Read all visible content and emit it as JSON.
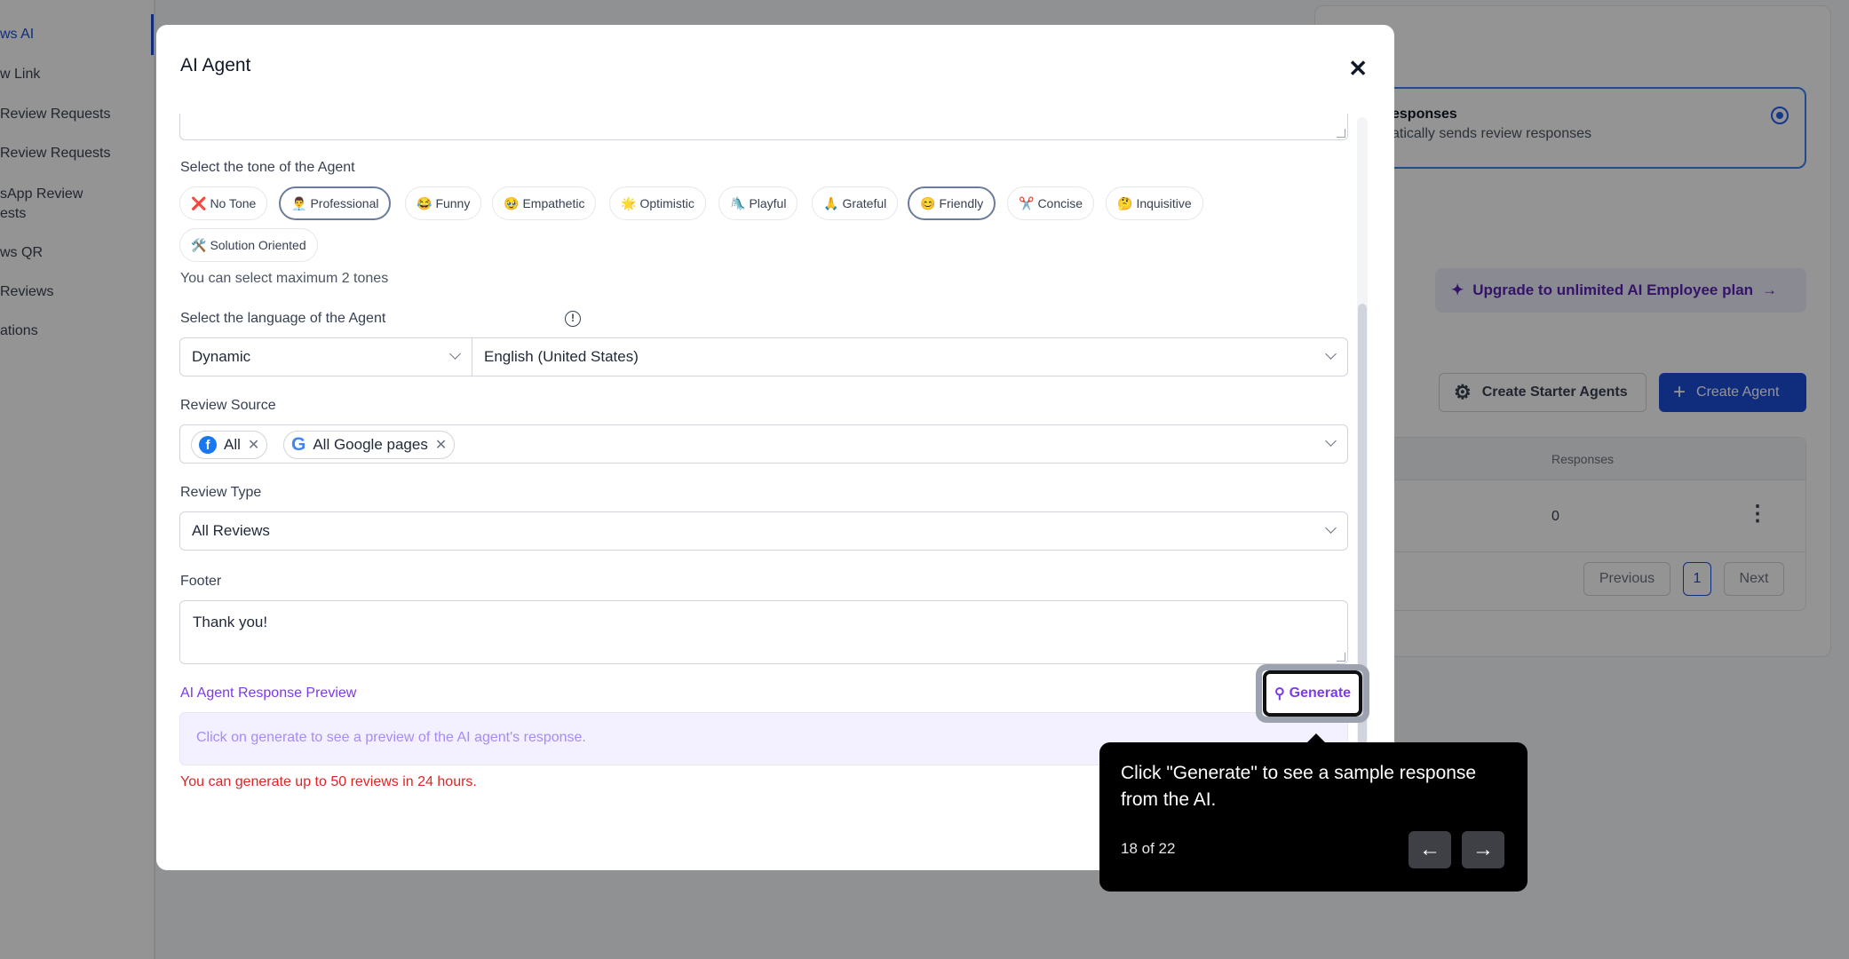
{
  "sidebar": {
    "items": [
      {
        "label": "ws AI",
        "active": true
      },
      {
        "label": "w Link"
      },
      {
        "label": "Review Requests"
      },
      {
        "label": " Review Requests"
      },
      {
        "label": "sApp Review"
      },
      {
        "label": "ests"
      },
      {
        "label": "ws QR"
      },
      {
        "label": " Reviews"
      },
      {
        "label": "ations"
      }
    ]
  },
  "background": {
    "option_card": {
      "title": "esponses",
      "subtitle": "atically sends review responses",
      "selected": true
    },
    "upgrade_label": "Upgrade to unlimited AI Employee plan",
    "create_starter_label": "Create Starter Agents",
    "create_agent_label": "Create Agent",
    "table": {
      "column": "Responses",
      "value": "0"
    },
    "pagination": {
      "previous": "Previous",
      "current": "1",
      "next": "Next"
    }
  },
  "modal": {
    "title": "AI Agent",
    "close_icon": "close-icon",
    "tone_label": "Select the tone of the Agent",
    "tones": [
      {
        "emoji": "❌",
        "label": "No Tone",
        "selected": false
      },
      {
        "emoji": "👨‍💼",
        "label": "Professional",
        "selected": true
      },
      {
        "emoji": "😂",
        "label": "Funny",
        "selected": false
      },
      {
        "emoji": "🥹",
        "label": "Empathetic",
        "selected": false
      },
      {
        "emoji": "🌟",
        "label": "Optimistic",
        "selected": false
      },
      {
        "emoji": "🛝",
        "label": "Playful",
        "selected": false
      },
      {
        "emoji": "🙏",
        "label": "Grateful",
        "selected": false
      },
      {
        "emoji": "😊",
        "label": "Friendly",
        "selected": true
      },
      {
        "emoji": "✂️",
        "label": "Concise",
        "selected": false
      },
      {
        "emoji": "🤔",
        "label": "Inquisitive",
        "selected": false
      },
      {
        "emoji": "🛠️",
        "label": "Solution Oriented",
        "selected": false
      }
    ],
    "tone_hint": "You can select maximum 2 tones",
    "language_label": "Select the language of the Agent",
    "language_mode": "Dynamic",
    "language_value": "English (United States)",
    "review_source_label": "Review Source",
    "review_sources": [
      {
        "icon": "facebook-icon",
        "label": "All"
      },
      {
        "icon": "google-icon",
        "label": "All Google pages"
      }
    ],
    "review_type_label": "Review Type",
    "review_type_value": "All Reviews",
    "footer_label": "Footer",
    "footer_value": "Thank you!",
    "preview_label": "AI Agent Response Preview",
    "generate_label": "Generate",
    "preview_placeholder": "Click on generate to see a preview of the AI agent's response.",
    "limit_text": "You can generate up to 50 reviews in 24 hours."
  },
  "tour": {
    "message": "Click \"Generate\" to see a sample response from the AI.",
    "step": "18 of 22",
    "prev_icon": "arrow-left-icon",
    "next_icon": "arrow-right-icon"
  },
  "colors": {
    "accent_blue": "#1d4ed8",
    "accent_purple": "#7c3aed",
    "error_red": "#dc2626",
    "preview_bg": "#f3f0ff"
  }
}
